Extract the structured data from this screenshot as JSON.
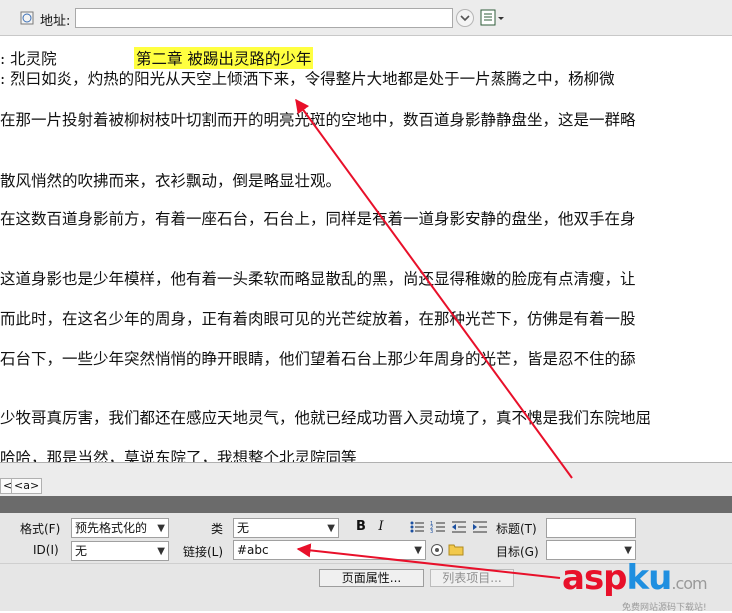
{
  "address_bar": {
    "label": "地址:",
    "value": ""
  },
  "document": {
    "line0_prefix": ":  北灵院",
    "title": "第二章  被踢出灵路的少年",
    "lines": [
      ":    烈曰如炎，灼热的阳光从天空上倾洒下来，令得整片大地都是处于一片蒸腾之中，杨柳微",
      "在那一片投射着被柳树枝叶切割而开的明亮光斑的空地中，数百道身影静静盘坐，这是一群略",
      "散风悄然的吹拂而来，衣衫飘动，倒是略显壮观。",
      "在这数百道身影前方，有着一座石台，石台上，同样是有着一道身影安静的盘坐，他双手在身",
      "这道身影也是少年模样，他有着一头柔软而略显散乱的黑，尚还显得稚嫩的脸庞有点清瘦，让",
      "而此时，在这名少年的周身，正有着肉眼可见的光芒绽放着，在那种光芒下，仿佛是有着一股",
      "石台下，一些少年突然悄悄的睁开眼睛，他们望着石台上那少年周身的光芒，皆是忍不住的舔",
      "少牧哥真厉害，我们都还在感应天地灵气，他就已经成功晋入灵动境了，真不愧是我们东院地屈",
      "哈哈，那是当然，莫说东院了，我想整个北灵院同等"
    ]
  },
  "tag_selector": {
    "tags": [
      "<",
      "<a>"
    ]
  },
  "properties": {
    "format_label": "格式(F)",
    "format_value": "预先格式化的",
    "id_label": "ID(I)",
    "id_value": "无",
    "class_label": "类",
    "class_value": "无",
    "link_label": "链接(L)",
    "link_value": "#abc",
    "bold_label": "B",
    "italic_label": "I",
    "title_label": "标题(T)",
    "title_value": "",
    "target_label": "目标(G)",
    "target_value": "",
    "page_props_button": "页面属性...",
    "list_item_button": "列表项目..."
  },
  "watermark": {
    "brand_a": "asp",
    "brand_b": "ku",
    "brand_c": ".com",
    "sub": "免费网站源码下载站!"
  },
  "colors": {
    "highlight": "#ffff40",
    "arrow": "#e8102a",
    "watermark_red": "#e8102a",
    "watermark_blue": "#1f8fe0"
  }
}
